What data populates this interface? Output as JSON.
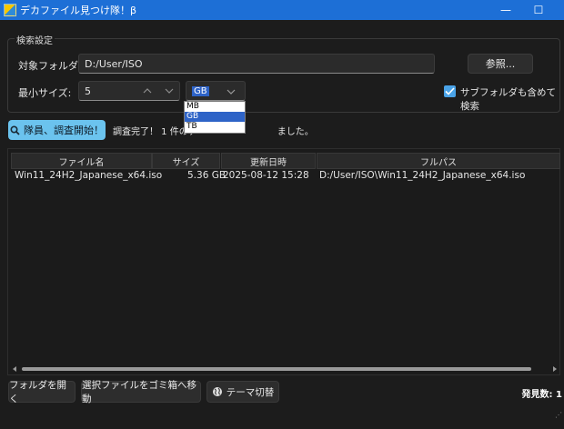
{
  "window": {
    "title": "デカファイル見つけ隊！β",
    "minimize_glyph": "—",
    "maximize_glyph": "☐"
  },
  "search_group": {
    "label": "検索設定",
    "folder_label": "対象フォルダ:",
    "folder_value": "D:/User/ISO",
    "browse_label": "参照...",
    "min_size_label": "最小サイズ:",
    "min_size_value": "5",
    "unit_value": "GB",
    "unit_options": [
      "MB",
      "GB",
      "TB"
    ],
    "unit_selected_index": 1,
    "subfolder_label": "サブフォルダも含めて検索",
    "subfolder_checked": true
  },
  "action": {
    "start_label": "隊員、調査開始！",
    "status_left": "調査完了！ 1 件のデ",
    "status_right": "ました。"
  },
  "table": {
    "headers": [
      "ファイル名",
      "サイズ",
      "更新日時",
      "フルパス"
    ],
    "rows": [
      {
        "name": "Win11_24H2_Japanese_x64.iso",
        "size": "5.36 GB",
        "modified": "2025-08-12 15:28",
        "path": "D:/User/ISO\\Win11_24H2_Japanese_x64.iso"
      }
    ]
  },
  "footer": {
    "open_folder_label": "フォルダを開く",
    "trash_label": "選択ファイルをゴミ箱へ移動",
    "theme_label": "テーマ切替",
    "count_label": "発見数: 1"
  },
  "icons": {
    "search": "magnifier-icon",
    "theme": "globe-icon",
    "check": "checkmark-icon",
    "up": "spin-up-icon",
    "down": "spin-down-icon",
    "combo": "chevron-down-icon"
  },
  "colors": {
    "titlebar": "#1d6fd6",
    "accent": "#6bc3ee",
    "selection": "#2e63c7",
    "background": "#1c1c1c"
  }
}
